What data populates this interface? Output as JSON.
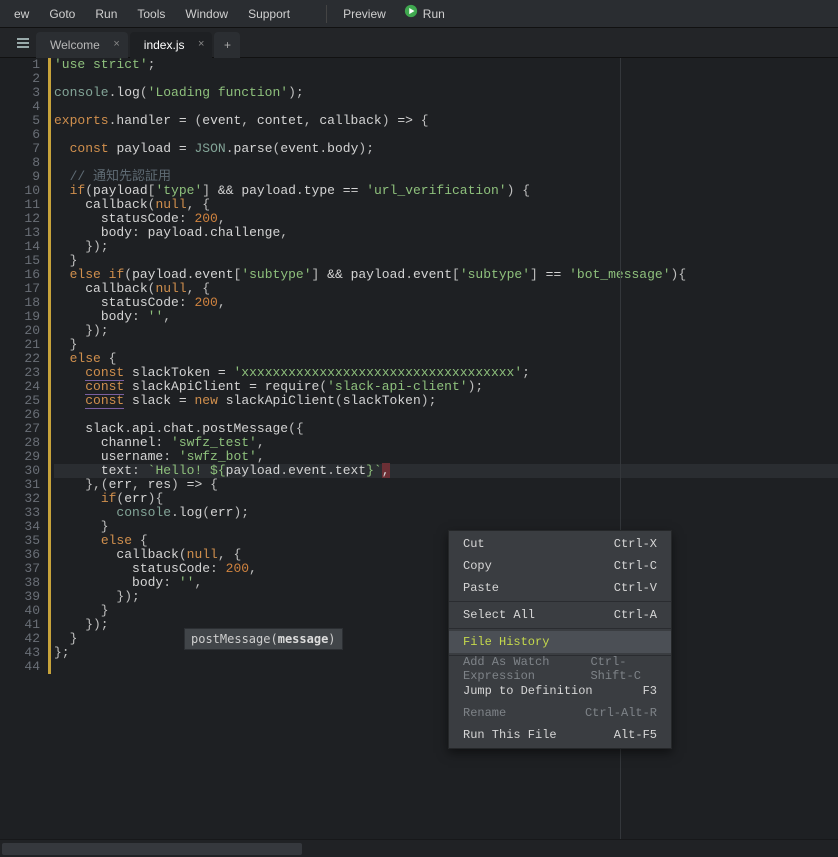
{
  "menubar": {
    "items": [
      "ew",
      "Goto",
      "Run",
      "Tools",
      "Window",
      "Support"
    ],
    "preview_label": "Preview",
    "run_label": "Run"
  },
  "tabs": {
    "items": [
      {
        "label": "Welcome",
        "active": false
      },
      {
        "label": "index.js",
        "active": true
      }
    ]
  },
  "editor": {
    "line_count": 44,
    "current_line_index": 29
  },
  "hint": {
    "fn": "postMessage",
    "arg": "message"
  },
  "context_menu": {
    "items": [
      {
        "label": "Cut",
        "short": "Ctrl-X",
        "disabled": false
      },
      {
        "label": "Copy",
        "short": "Ctrl-C",
        "disabled": false
      },
      {
        "label": "Paste",
        "short": "Ctrl-V",
        "disabled": false
      },
      {
        "sep": true
      },
      {
        "label": "Select All",
        "short": "Ctrl-A",
        "disabled": false
      },
      {
        "sep": true
      },
      {
        "label": "File History",
        "short": "",
        "disabled": false,
        "hl": true,
        "hover": true
      },
      {
        "sep": true
      },
      {
        "label": "Add As Watch Expression",
        "short": "Ctrl-Shift-C",
        "disabled": true
      },
      {
        "label": "Jump to Definition",
        "short": "F3",
        "disabled": false
      },
      {
        "label": "Rename",
        "short": "Ctrl-Alt-R",
        "disabled": true
      },
      {
        "label": "Run This File",
        "short": "Alt-F5",
        "disabled": false
      }
    ]
  },
  "code_lines": [
    [
      [
        "t-str",
        "'use strict'"
      ],
      [
        "t-punc",
        ";"
      ]
    ],
    [],
    [
      [
        "t-builtin",
        "console"
      ],
      [
        "t-punc",
        "."
      ],
      [
        "t-fn",
        "log"
      ],
      [
        "t-punc",
        "("
      ],
      [
        "t-str",
        "'Loading function'"
      ],
      [
        "t-punc",
        ");"
      ]
    ],
    [],
    [
      [
        "t-kw",
        "exports"
      ],
      [
        "t-punc",
        "."
      ],
      [
        "t-fn",
        "handler"
      ],
      [
        "t-punc",
        " "
      ],
      [
        "t-op",
        "="
      ],
      [
        "t-punc",
        " ("
      ],
      [
        "t-param",
        "event"
      ],
      [
        "t-punc",
        ", "
      ],
      [
        "t-param",
        "contet"
      ],
      [
        "t-punc",
        ", "
      ],
      [
        "t-param",
        "callback"
      ],
      [
        "t-punc",
        ")"
      ],
      [
        "t-punc",
        " "
      ],
      [
        "t-op",
        "=>"
      ],
      [
        "t-punc",
        " {"
      ]
    ],
    [],
    [
      [
        "t-punc",
        "  "
      ],
      [
        "t-kw",
        "const"
      ],
      [
        "t-punc",
        " "
      ],
      [
        "t-param",
        "payload"
      ],
      [
        "t-punc",
        " "
      ],
      [
        "t-op",
        "="
      ],
      [
        "t-punc",
        " "
      ],
      [
        "t-builtin",
        "JSON"
      ],
      [
        "t-punc",
        "."
      ],
      [
        "t-fn",
        "parse"
      ],
      [
        "t-punc",
        "("
      ],
      [
        "t-param",
        "event"
      ],
      [
        "t-punc",
        "."
      ],
      [
        "t-fn",
        "body"
      ],
      [
        "t-punc",
        ");"
      ]
    ],
    [],
    [
      [
        "t-punc",
        "  "
      ],
      [
        "t-cmt",
        "// 通知先認証用"
      ]
    ],
    [
      [
        "t-punc",
        "  "
      ],
      [
        "t-kw",
        "if"
      ],
      [
        "t-punc",
        "("
      ],
      [
        "t-param",
        "payload"
      ],
      [
        "t-punc",
        "["
      ],
      [
        "t-str",
        "'type'"
      ],
      [
        "t-punc",
        "]"
      ],
      [
        "t-punc",
        " "
      ],
      [
        "t-op",
        "&&"
      ],
      [
        "t-punc",
        " "
      ],
      [
        "t-param",
        "payload"
      ],
      [
        "t-punc",
        "."
      ],
      [
        "t-fn",
        "type"
      ],
      [
        "t-punc",
        " "
      ],
      [
        "t-op",
        "=="
      ],
      [
        "t-punc",
        " "
      ],
      [
        "t-str",
        "'url_verification'"
      ],
      [
        "t-punc",
        ")"
      ],
      [
        "t-punc",
        " {"
      ]
    ],
    [
      [
        "t-punc",
        "    "
      ],
      [
        "t-fn",
        "callback"
      ],
      [
        "t-punc",
        "("
      ],
      [
        "t-null",
        "null"
      ],
      [
        "t-punc",
        ", {"
      ]
    ],
    [
      [
        "t-punc",
        "      "
      ],
      [
        "t-fn",
        "statusCode"
      ],
      [
        "t-punc",
        ": "
      ],
      [
        "t-num",
        "200"
      ],
      [
        "t-punc",
        ","
      ]
    ],
    [
      [
        "t-punc",
        "      "
      ],
      [
        "t-fn",
        "body"
      ],
      [
        "t-punc",
        ": "
      ],
      [
        "t-param",
        "payload"
      ],
      [
        "t-punc",
        "."
      ],
      [
        "t-fn",
        "challenge"
      ],
      [
        "t-punc",
        ","
      ]
    ],
    [
      [
        "t-punc",
        "    });"
      ]
    ],
    [
      [
        "t-punc",
        "  }"
      ]
    ],
    [
      [
        "t-punc",
        "  "
      ],
      [
        "t-kw",
        "else"
      ],
      [
        "t-punc",
        " "
      ],
      [
        "t-kw",
        "if"
      ],
      [
        "t-punc",
        "("
      ],
      [
        "t-param",
        "payload"
      ],
      [
        "t-punc",
        "."
      ],
      [
        "t-fn",
        "event"
      ],
      [
        "t-punc",
        "["
      ],
      [
        "t-str",
        "'subtype'"
      ],
      [
        "t-punc",
        "]"
      ],
      [
        "t-punc",
        " "
      ],
      [
        "t-op",
        "&&"
      ],
      [
        "t-punc",
        " "
      ],
      [
        "t-param",
        "payload"
      ],
      [
        "t-punc",
        "."
      ],
      [
        "t-fn",
        "event"
      ],
      [
        "t-punc",
        "["
      ],
      [
        "t-str",
        "'subtype'"
      ],
      [
        "t-punc",
        "]"
      ],
      [
        "t-punc",
        " "
      ],
      [
        "t-op",
        "=="
      ],
      [
        "t-punc",
        " "
      ],
      [
        "t-str",
        "'bot_message'"
      ],
      [
        "t-punc",
        "){"
      ]
    ],
    [
      [
        "t-punc",
        "    "
      ],
      [
        "t-fn",
        "callback"
      ],
      [
        "t-punc",
        "("
      ],
      [
        "t-null",
        "null"
      ],
      [
        "t-punc",
        ", {"
      ]
    ],
    [
      [
        "t-punc",
        "      "
      ],
      [
        "t-fn",
        "statusCode"
      ],
      [
        "t-punc",
        ": "
      ],
      [
        "t-num",
        "200"
      ],
      [
        "t-punc",
        ","
      ]
    ],
    [
      [
        "t-punc",
        "      "
      ],
      [
        "t-fn",
        "body"
      ],
      [
        "t-punc",
        ": "
      ],
      [
        "t-str",
        "''"
      ],
      [
        "t-punc",
        ","
      ]
    ],
    [
      [
        "t-punc",
        "    });"
      ]
    ],
    [
      [
        "t-punc",
        "  }"
      ]
    ],
    [
      [
        "t-punc",
        "  "
      ],
      [
        "t-kw",
        "else"
      ],
      [
        "t-punc",
        " {"
      ]
    ],
    [
      [
        "t-punc",
        "    "
      ],
      [
        "t-decl",
        "const"
      ],
      [
        "t-punc",
        " "
      ],
      [
        "t-param",
        "slackToken"
      ],
      [
        "t-punc",
        " "
      ],
      [
        "t-op",
        "="
      ],
      [
        "t-punc",
        " "
      ],
      [
        "t-str",
        "'xxxxxxxxxxxxxxxxxxxxxxxxxxxxxxxxxxx'"
      ],
      [
        "t-punc",
        ";"
      ]
    ],
    [
      [
        "t-punc",
        "    "
      ],
      [
        "t-decl",
        "const"
      ],
      [
        "t-punc",
        " "
      ],
      [
        "t-param",
        "slackApiClient"
      ],
      [
        "t-punc",
        " "
      ],
      [
        "t-op",
        "="
      ],
      [
        "t-punc",
        " "
      ],
      [
        "t-fn",
        "require"
      ],
      [
        "t-punc",
        "("
      ],
      [
        "t-str",
        "'slack-api-client'"
      ],
      [
        "t-punc",
        ");"
      ]
    ],
    [
      [
        "t-punc",
        "    "
      ],
      [
        "t-decl",
        "const"
      ],
      [
        "t-punc",
        " "
      ],
      [
        "t-param",
        "slack"
      ],
      [
        "t-punc",
        " "
      ],
      [
        "t-op",
        "="
      ],
      [
        "t-punc",
        " "
      ],
      [
        "t-kw",
        "new"
      ],
      [
        "t-punc",
        " "
      ],
      [
        "t-fn",
        "slackApiClient"
      ],
      [
        "t-punc",
        "("
      ],
      [
        "t-param",
        "slackToken"
      ],
      [
        "t-punc",
        ");"
      ]
    ],
    [],
    [
      [
        "t-punc",
        "    "
      ],
      [
        "t-param",
        "slack"
      ],
      [
        "t-punc",
        "."
      ],
      [
        "t-fn",
        "api"
      ],
      [
        "t-punc",
        "."
      ],
      [
        "t-fn",
        "chat"
      ],
      [
        "t-punc",
        "."
      ],
      [
        "t-fn",
        "postMessage"
      ],
      [
        "t-punc",
        "({"
      ]
    ],
    [
      [
        "t-punc",
        "      "
      ],
      [
        "t-fn",
        "channel"
      ],
      [
        "t-punc",
        ": "
      ],
      [
        "t-str",
        "'swfz_test'"
      ],
      [
        "t-punc",
        ","
      ]
    ],
    [
      [
        "t-punc",
        "      "
      ],
      [
        "t-fn",
        "username"
      ],
      [
        "t-punc",
        ": "
      ],
      [
        "t-str",
        "'swfz_bot'"
      ],
      [
        "t-punc",
        ","
      ]
    ],
    [
      [
        "t-punc",
        "      "
      ],
      [
        "t-fn",
        "text"
      ],
      [
        "t-punc",
        ": "
      ],
      [
        "t-str",
        "`Hello! ${"
      ],
      [
        "t-param",
        "payload"
      ],
      [
        "t-punc",
        "."
      ],
      [
        "t-fn",
        "event"
      ],
      [
        "t-punc",
        "."
      ],
      [
        "t-fn",
        "text"
      ],
      [
        "t-str",
        "}`"
      ],
      [
        "cursor-mark",
        ","
      ]
    ],
    [
      [
        "t-punc",
        "    },("
      ],
      [
        "t-param",
        "err"
      ],
      [
        "t-punc",
        ", "
      ],
      [
        "t-param",
        "res"
      ],
      [
        "t-punc",
        ")"
      ],
      [
        "t-punc",
        " "
      ],
      [
        "t-op",
        "=>"
      ],
      [
        "t-punc",
        " {"
      ]
    ],
    [
      [
        "t-punc",
        "      "
      ],
      [
        "t-kw",
        "if"
      ],
      [
        "t-punc",
        "("
      ],
      [
        "t-param",
        "err"
      ],
      [
        "t-punc",
        "){"
      ]
    ],
    [
      [
        "t-punc",
        "        "
      ],
      [
        "t-builtin",
        "console"
      ],
      [
        "t-punc",
        "."
      ],
      [
        "t-fn",
        "log"
      ],
      [
        "t-punc",
        "("
      ],
      [
        "t-param",
        "err"
      ],
      [
        "t-punc",
        ");"
      ]
    ],
    [
      [
        "t-punc",
        "      }"
      ]
    ],
    [
      [
        "t-punc",
        "      "
      ],
      [
        "t-kw",
        "else"
      ],
      [
        "t-punc",
        " {"
      ]
    ],
    [
      [
        "t-punc",
        "        "
      ],
      [
        "t-fn",
        "callback"
      ],
      [
        "t-punc",
        "("
      ],
      [
        "t-null",
        "null"
      ],
      [
        "t-punc",
        ", {"
      ]
    ],
    [
      [
        "t-punc",
        "          "
      ],
      [
        "t-fn",
        "statusCode"
      ],
      [
        "t-punc",
        ": "
      ],
      [
        "t-num",
        "200"
      ],
      [
        "t-punc",
        ","
      ]
    ],
    [
      [
        "t-punc",
        "          "
      ],
      [
        "t-fn",
        "body"
      ],
      [
        "t-punc",
        ": "
      ],
      [
        "t-str",
        "''"
      ],
      [
        "t-punc",
        ","
      ]
    ],
    [
      [
        "t-punc",
        "        });"
      ]
    ],
    [
      [
        "t-punc",
        "      }"
      ]
    ],
    [
      [
        "t-punc",
        "    });"
      ]
    ],
    [
      [
        "t-punc",
        "  }"
      ]
    ],
    [
      [
        "t-punc",
        "};"
      ]
    ],
    []
  ]
}
